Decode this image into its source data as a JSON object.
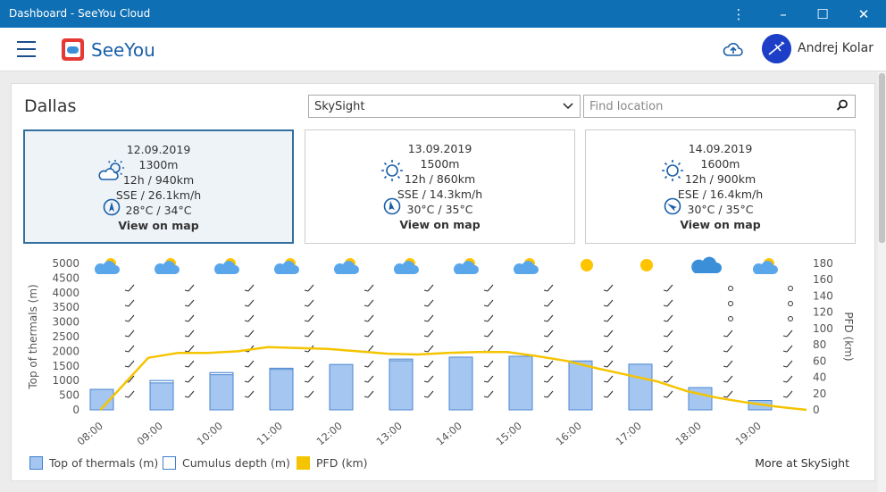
{
  "window": {
    "title": "Dashboard - SeeYou Cloud",
    "controls": [
      "⋮",
      "–",
      "☐",
      "✕"
    ]
  },
  "appbar": {
    "brand": "SeeYou",
    "user": "Andrej Kolar"
  },
  "location": "Dallas",
  "provider": {
    "selected": "SkySight"
  },
  "search": {
    "placeholder": "Find location"
  },
  "days": [
    {
      "date": "12.09.2019",
      "height": "1300m",
      "task": "12h / 940km",
      "wind": "SSE / 26.1km/h",
      "temp": "28°C / 34°C",
      "link": "View on map",
      "icon": "partly-cloudy-icon",
      "active": true
    },
    {
      "date": "13.09.2019",
      "height": "1500m",
      "task": "12h / 860km",
      "wind": "SSE / 14.3km/h",
      "temp": "30°C / 35°C",
      "link": "View on map",
      "icon": "sun-icon",
      "active": false
    },
    {
      "date": "14.09.2019",
      "height": "1600m",
      "task": "12h / 900km",
      "wind": "ESE / 16.4km/h",
      "temp": "30°C / 35°C",
      "link": "View on map",
      "icon": "sun-icon",
      "active": false
    }
  ],
  "chart_data": {
    "type": "bar",
    "categories": [
      "08:00",
      "09:00",
      "10:00",
      "11:00",
      "12:00",
      "13:00",
      "14:00",
      "15:00",
      "16:00",
      "17:00",
      "18:00",
      "19:00"
    ],
    "ylabel": "Top of thermals (m)",
    "ylabel_right": "PFD (km)",
    "yticks": [
      "0",
      "500",
      "1000",
      "1500",
      "2000",
      "2500",
      "3000",
      "3500",
      "4000",
      "4500",
      "5000"
    ],
    "yticks_right": [
      "0",
      "20",
      "40",
      "60",
      "80",
      "100",
      "120",
      "140",
      "160",
      "180"
    ],
    "ylim": [
      0,
      5000
    ],
    "ylim_right": [
      0,
      180
    ],
    "series": [
      {
        "name": "Top of thermals (m)",
        "type": "bar",
        "color": "#a5c6f0",
        "values": [
          700,
          1000,
          1270,
          1420,
          1550,
          1730,
          1800,
          1830,
          1670,
          1560,
          760,
          320
        ]
      },
      {
        "name": "Cumulus depth (m)",
        "type": "bar-outline",
        "color": "#3f7fcf",
        "values": [
          0,
          80,
          70,
          40,
          0,
          50,
          0,
          0,
          0,
          0,
          0,
          0
        ]
      },
      {
        "name": "PFD (km)",
        "type": "line",
        "color": "#f5c400",
        "x": [
          0.2,
          1,
          1.5,
          2,
          2.5,
          3,
          3.5,
          4,
          4.5,
          5,
          5.5,
          6,
          6.5,
          7,
          7.5,
          8,
          8.5,
          9,
          9.5,
          10,
          10.5,
          11,
          11.5,
          12
        ],
        "values": [
          0,
          64,
          70,
          70,
          72,
          77,
          76,
          75,
          72,
          69,
          68,
          70,
          71,
          71,
          66,
          60,
          51,
          43,
          35,
          23,
          15,
          9,
          4,
          0
        ]
      }
    ],
    "weather_icons": [
      "partly-cloudy-icon",
      "partly-cloudy-icon",
      "partly-cloudy-icon",
      "partly-cloudy-icon",
      "partly-cloudy-icon",
      "partly-cloudy-icon",
      "partly-cloudy-icon",
      "partly-cloudy-icon",
      "sun-icon",
      "sun-icon",
      "cloud-icon",
      "partly-cloudy-icon"
    ],
    "legend": [
      "Top of thermals (m)",
      "Cumulus depth (m)",
      "PFD (km)"
    ],
    "more_link": "More at SkySight"
  }
}
